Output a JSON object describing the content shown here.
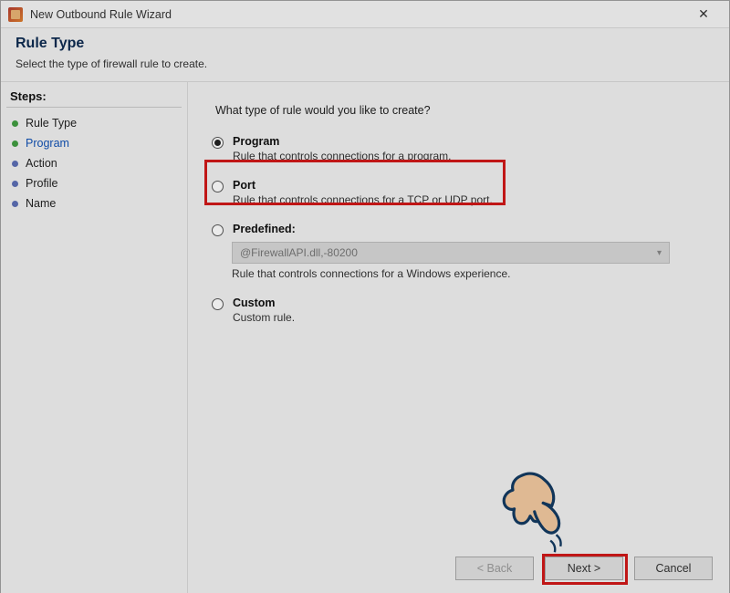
{
  "window": {
    "title": "New Outbound Rule Wizard",
    "close_glyph": "✕"
  },
  "header": {
    "title": "Rule Type",
    "subtitle": "Select the type of firewall rule to create."
  },
  "sidebar": {
    "title": "Steps:",
    "items": [
      {
        "label": "Rule Type",
        "state": "done"
      },
      {
        "label": "Program",
        "state": "active"
      },
      {
        "label": "Action",
        "state": "pending"
      },
      {
        "label": "Profile",
        "state": "pending"
      },
      {
        "label": "Name",
        "state": "pending"
      }
    ]
  },
  "main": {
    "question": "What type of rule would you like to create?",
    "options": [
      {
        "id": "program",
        "label": "Program",
        "desc": "Rule that controls connections for a program.",
        "selected": true
      },
      {
        "id": "port",
        "label": "Port",
        "desc": "Rule that controls connections for a TCP or UDP port.",
        "selected": false
      },
      {
        "id": "predefined",
        "label": "Predefined:",
        "desc": "Rule that controls connections for a Windows experience.",
        "selected": false,
        "dropdown_value": "@FirewallAPI.dll,-80200",
        "dropdown_disabled": true
      },
      {
        "id": "custom",
        "label": "Custom",
        "desc": "Custom rule.",
        "selected": false
      }
    ],
    "buttons": {
      "back": "< Back",
      "next": "Next >",
      "cancel": "Cancel",
      "back_enabled": false
    }
  },
  "highlights": {
    "program_option": true,
    "next_button": true
  }
}
